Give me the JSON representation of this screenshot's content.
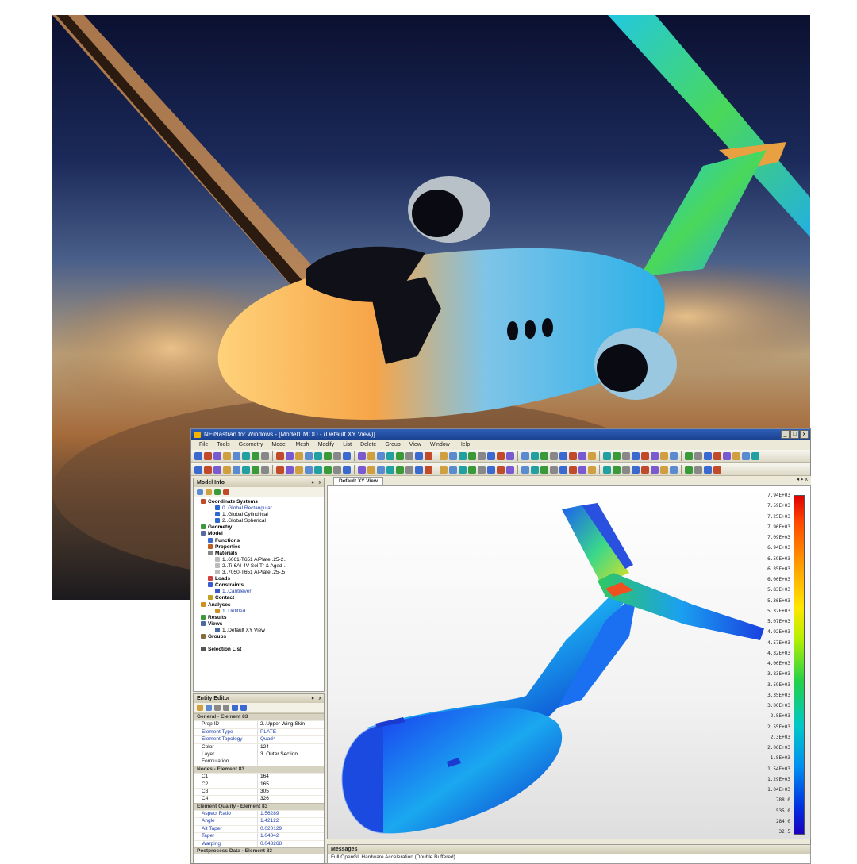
{
  "app": {
    "title": "NEiNastran for Windows - [Model1.MOD - (Default XY View)]",
    "window_controls": [
      "_",
      "□",
      "x"
    ],
    "menu": [
      "File",
      "Tools",
      "Geometry",
      "Model",
      "Mesh",
      "Modify",
      "List",
      "Delete",
      "Group",
      "View",
      "Window",
      "Help"
    ]
  },
  "model_info": {
    "title": "Model Info",
    "pin": "♦",
    "close": "x",
    "tree": [
      {
        "label": "Coordinate Systems",
        "bold": true,
        "indent": 1,
        "icon_color": "#c04a2a"
      },
      {
        "label": "0..Global Rectangular",
        "blue": true,
        "indent": 3,
        "icon_color": "#2a6ad0"
      },
      {
        "label": "1..Global Cylindrical",
        "indent": 3,
        "icon_color": "#2a6ad0"
      },
      {
        "label": "2..Global Spherical",
        "indent": 3,
        "icon_color": "#2a6ad0"
      },
      {
        "label": "Geometry",
        "bold": true,
        "indent": 1,
        "icon_color": "#3a9a3a"
      },
      {
        "label": "Model",
        "bold": true,
        "indent": 1,
        "icon_color": "#5a6aa0"
      },
      {
        "label": "Functions",
        "bold": true,
        "indent": 2,
        "icon_color": "#3a6ad0"
      },
      {
        "label": "Properties",
        "bold": true,
        "indent": 2,
        "icon_color": "#c06020"
      },
      {
        "label": "Materials",
        "bold": true,
        "indent": 2,
        "icon_color": "#888888"
      },
      {
        "label": "1..6061-T651 AlPlate .25-2..",
        "indent": 3,
        "icon_color": "#bbbbbb"
      },
      {
        "label": "2..Ti-6Al-4V Sol Tr & Aged ..",
        "indent": 3,
        "icon_color": "#bbbbbb"
      },
      {
        "label": "3..7050-T651 AlPlate .25-.5",
        "indent": 3,
        "icon_color": "#bbbbbb"
      },
      {
        "label": "Loads",
        "bold": true,
        "indent": 2,
        "icon_color": "#d04040"
      },
      {
        "label": "Constraints",
        "bold": true,
        "indent": 2,
        "icon_color": "#3a5ad0"
      },
      {
        "label": "1..Cantilever",
        "blue": true,
        "indent": 3,
        "icon_color": "#3a5ad0"
      },
      {
        "label": "Contact",
        "bold": true,
        "indent": 2,
        "icon_color": "#c0a020"
      },
      {
        "label": "Analyses",
        "bold": true,
        "indent": 1,
        "icon_color": "#d09020"
      },
      {
        "label": "1..Untitled",
        "blue": true,
        "indent": 3,
        "icon_color": "#d09020"
      },
      {
        "label": "Results",
        "bold": true,
        "indent": 1,
        "icon_color": "#3a9a3a"
      },
      {
        "label": "Views",
        "bold": true,
        "indent": 1,
        "icon_color": "#4a6aa0"
      },
      {
        "label": "1..Default XY View",
        "indent": 3,
        "icon_color": "#4a6aa0"
      },
      {
        "label": "Groups",
        "bold": true,
        "indent": 1,
        "icon_color": "#8a6a3a"
      },
      {
        "label": "",
        "indent": 1,
        "icon_color": "transparent"
      },
      {
        "label": "Selection List",
        "bold": true,
        "indent": 1,
        "icon_color": "#555555"
      }
    ]
  },
  "entity_editor": {
    "title": "Entity Editor",
    "pin": "♦",
    "close": "x",
    "sections": [
      {
        "title": "General - Element 83",
        "rows": [
          {
            "k": "Prop ID",
            "v": "2..Upper Wing Skin"
          },
          {
            "k": "Element Type",
            "v": "PLATE",
            "kblue": true,
            "vblue": true
          },
          {
            "k": "Element Topology",
            "v": "Quad4",
            "kblue": true,
            "vblue": true
          },
          {
            "k": "Color",
            "v": "124"
          },
          {
            "k": "Layer",
            "v": "3..Outer Section"
          },
          {
            "k": "Formulation",
            "v": ""
          }
        ]
      },
      {
        "title": "Nodes - Element 83",
        "rows": [
          {
            "k": "C1",
            "v": "164"
          },
          {
            "k": "C2",
            "v": "165"
          },
          {
            "k": "C3",
            "v": "305"
          },
          {
            "k": "C4",
            "v": "326"
          }
        ]
      },
      {
        "title": "Element Quality - Element 83",
        "rows": [
          {
            "k": "Aspect Ratio",
            "v": "1.56289",
            "kblue": true,
            "vblue": true
          },
          {
            "k": "Angle",
            "v": "1.42122",
            "kblue": true,
            "vblue": true
          },
          {
            "k": "Alt Taper",
            "v": "0.020129",
            "kblue": true,
            "vblue": true
          },
          {
            "k": "Taper",
            "v": "1.04042",
            "kblue": true,
            "vblue": true
          },
          {
            "k": "Warping",
            "v": "0.043268",
            "kblue": true,
            "vblue": true
          }
        ]
      },
      {
        "title": "Postprocess Data - Element 83",
        "rows": []
      }
    ]
  },
  "view": {
    "tab": "Default XY View",
    "controls": "◂ ▸ x"
  },
  "legend": {
    "labels": [
      "7.94E+03",
      "7.59E+03",
      "7.25E+03",
      "7.96E+03",
      "7.09E+03",
      "6.94E+03",
      "6.59E+03",
      "6.35E+03",
      "6.00E+03",
      "5.83E+03",
      "5.36E+03",
      "5.32E+03",
      "5.07E+03",
      "4.92E+03",
      "4.57E+03",
      "4.32E+03",
      "4.00E+03",
      "3.83E+03",
      "3.59E+03",
      "3.35E+03",
      "3.00E+03",
      "2.8E+03",
      "2.55E+03",
      "2.3E+03",
      "2.06E+03",
      "1.8E+03",
      "1.54E+03",
      "1.29E+03",
      "1.04E+03",
      "788.0",
      "535.0",
      "284.0",
      "32.5"
    ]
  },
  "messages": {
    "title": "Messages",
    "text": "Full OpenGL Hardware Acceleration (Double Buffered)"
  }
}
